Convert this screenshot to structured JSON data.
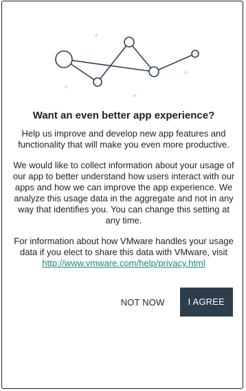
{
  "dialog": {
    "title": "Want an even better app experience?",
    "intro": "Help us improve and develop new app features and functionality that will make you even more productive.",
    "details": "We would like to collect information about your usage of our app to better understand how users interact with our apps and how we can improve the app experience. We analyze this usage data in the aggregate and not in any way that identifies you. You can change this setting at any time.",
    "privacy_text": "For information about how VMware handles your usage data if you elect to share this data with VMware, visit",
    "privacy_link": "http://www.vmware.com/help/privacy.html"
  },
  "actions": {
    "not_now": "NOT NOW",
    "agree": "I AGREE"
  },
  "colors": {
    "accent_link": "#17897a",
    "primary_button": "#2f3e4d"
  },
  "illustration": {
    "icon": "network-graph-icon"
  }
}
